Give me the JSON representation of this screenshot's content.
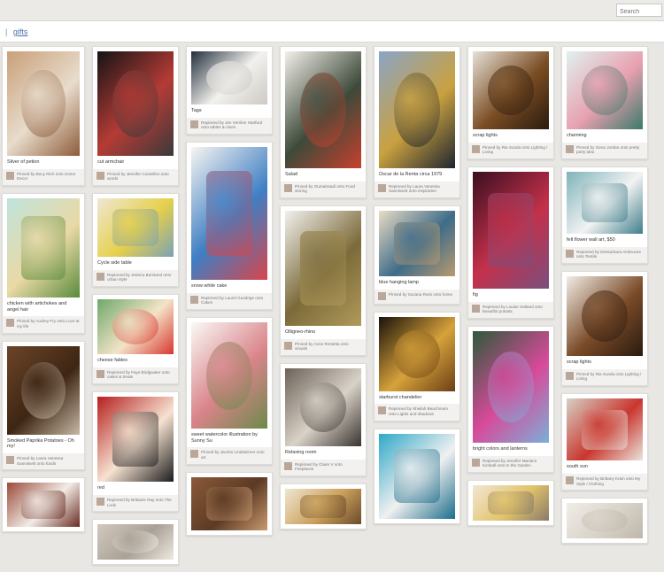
{
  "search": {
    "placeholder": "Search"
  },
  "breadcrumb": {
    "separator": "|",
    "link": "gifts"
  },
  "columns": [
    [
      {
        "caption": "Silver of petion",
        "meta": "Pinned by Bucy Rich onto Home Decor",
        "colors": [
          "#c9a07a",
          "#e8dccb",
          "#8d5b3a"
        ],
        "h": 118
      },
      {
        "caption": "chicken with artichokes and angel hair",
        "meta": "Pinned by Audrey Fry onto Love at my life",
        "colors": [
          "#bfe3dd",
          "#e9d9a5",
          "#5a8b3c"
        ],
        "h": 112
      },
      {
        "caption": "Smoked Paprika Potatoes - Oh my!",
        "meta": "Pinned by Laura Vanessa Sannissett onto foods",
        "colors": [
          "#6b4427",
          "#3e2614",
          "#c7b8a5"
        ],
        "h": 100
      },
      {
        "caption": "",
        "meta": "",
        "colors": [
          "#9b4b3b",
          "#f2ece6",
          "#6a2a20"
        ],
        "h": 50
      }
    ],
    [
      {
        "caption": "cut armchair",
        "meta": "Pinned by Jennifer Cossellon onto words",
        "colors": [
          "#141414",
          "#b53b36",
          "#3a3a3a"
        ],
        "h": 118
      },
      {
        "caption": "Cycle side table",
        "meta": "Repinned by Jessica Burnland onto urban style",
        "colors": [
          "#efe7d6",
          "#e6d04b",
          "#7aa1b5"
        ],
        "h": 66
      },
      {
        "caption": "cheese fables",
        "meta": "Repinned by Faye Bridgwater onto cakes & treats",
        "colors": [
          "#6fa86a",
          "#f3e4c8",
          "#d8362e"
        ],
        "h": 62
      },
      {
        "caption": "red",
        "meta": "Repinned by Brittanie Ray onto The Look",
        "colors": [
          "#b51f1f",
          "#f6e2d0",
          "#1c1c1c"
        ],
        "h": 96
      },
      {
        "caption": "",
        "meta": "",
        "colors": [
          "#d1c9bd",
          "#a9a196",
          "#efe9e1"
        ],
        "h": 40
      }
    ],
    [
      {
        "caption": "Tags",
        "meta": "Repinned by Jen Verrilee Hartford onto tables & nines",
        "colors": [
          "#222f3b",
          "#f2f1ee",
          "#cdc9c2"
        ],
        "h": 60
      },
      {
        "caption": "snow white cake",
        "meta": "Repinned by Laurel Goodrige onto Cakes",
        "colors": [
          "#f7f5f1",
          "#3f7fc4",
          "#d8454a"
        ],
        "h": 150
      },
      {
        "caption": "sweet watercolor illustration by Sunny Su",
        "meta": "Pinned by Jacinto Lindsteimer onto art",
        "colors": [
          "#fbf9f6",
          "#d9848a",
          "#6b8a4a"
        ],
        "h": 120
      },
      {
        "caption": "",
        "meta": "",
        "colors": [
          "#8b5a3a",
          "#5c3a24",
          "#c99a70"
        ],
        "h": 60
      }
    ],
    [
      {
        "caption": "Salad",
        "meta": "Pinned by Oumaissadi onto Food storing",
        "colors": [
          "#f3f0ea",
          "#3d4a3a",
          "#c8402d"
        ],
        "h": 132
      },
      {
        "caption": "Olligneo-rhino",
        "meta": "Pinned by Anne Rostetta onto visuals",
        "colors": [
          "#f1f0ee",
          "#7c6b3a",
          "#b09a5a"
        ],
        "h": 130
      },
      {
        "caption": "Relaxing room",
        "meta": "Repinned by Claire V onto Fireplaces",
        "colors": [
          "#6c6259",
          "#d9d2c7",
          "#3a3330"
        ],
        "h": 88
      },
      {
        "caption": "",
        "meta": "",
        "colors": [
          "#f0e6d2",
          "#caa05b",
          "#6b4a2a"
        ],
        "h": 40
      }
    ],
    [
      {
        "caption": "Oscar de la Renta circa 1979",
        "meta": "Repinned by Laura Vanessa Sannissett onto inspiration",
        "colors": [
          "#8aa5c7",
          "#c9a13f",
          "#1e2430"
        ],
        "h": 132
      },
      {
        "caption": "blue hanging lamp",
        "meta": "Pinned by Suzana Ross onto home",
        "colors": [
          "#e9dcc4",
          "#3f6c8a",
          "#b99a6e"
        ],
        "h": 74
      },
      {
        "caption": "starburst chandelier",
        "meta": "Repinned by Sheilah Beachmum onto Lights and shadows",
        "colors": [
          "#1a120b",
          "#d6a23a",
          "#6a3e16"
        ],
        "h": 84
      },
      {
        "caption": "",
        "meta": "",
        "colors": [
          "#2fa8c9",
          "#f0f0f0",
          "#1c6d8b"
        ],
        "h": 96
      }
    ],
    [
      {
        "caption": "scrap lights",
        "meta": "Pinned by Ria Sunda onto Lighting / Living",
        "colors": [
          "#e6e1d7",
          "#7a4d23",
          "#2a1a10"
        ],
        "h": 88
      },
      {
        "caption": "fig",
        "meta": "Repinned by Louise Hetland onto beautiful potraits",
        "colors": [
          "#3a1020",
          "#c4304a",
          "#7a4f7e"
        ],
        "h": 132
      },
      {
        "caption": "bright colors and lanterns",
        "meta": "Repinned by Jennifer Mariano Kimball onto In the Garden",
        "colors": [
          "#2d5a3a",
          "#d84a9a",
          "#7ab0d8"
        ],
        "h": 126
      },
      {
        "caption": "",
        "meta": "",
        "colors": [
          "#f2e6d6",
          "#e2c46a",
          "#8a7a6a"
        ],
        "h": 40
      }
    ],
    [
      {
        "caption": "charming",
        "meta": "Pinned by Gena Jordan onto pretty party idea",
        "colors": [
          "#dff1ef",
          "#e8a0b0",
          "#3a7a6a"
        ],
        "h": 88
      },
      {
        "caption": "felt flower wall art, $50",
        "meta": "Repinned by Dessa/Sara Ambrucee onto Textile",
        "colors": [
          "#7fb3b9",
          "#f3f3f3",
          "#3e7e8a"
        ],
        "h": 70
      },
      {
        "caption": "scrap lights",
        "meta": "Pinned by Ria Sunda onto Lighting / Living",
        "colors": [
          "#f1ede6",
          "#7a4b28",
          "#2a1a10"
        ],
        "h": 90
      },
      {
        "caption": "south sun",
        "meta": "Repinned by Brittany Krain onto My Style / Clothing",
        "colors": [
          "#d7d0c5",
          "#c9362e",
          "#e9e4dc"
        ],
        "h": 70
      },
      {
        "caption": "",
        "meta": "",
        "colors": [
          "#f0ede8",
          "#d8d2c8",
          "#bfb7ab"
        ],
        "h": 40
      }
    ]
  ]
}
